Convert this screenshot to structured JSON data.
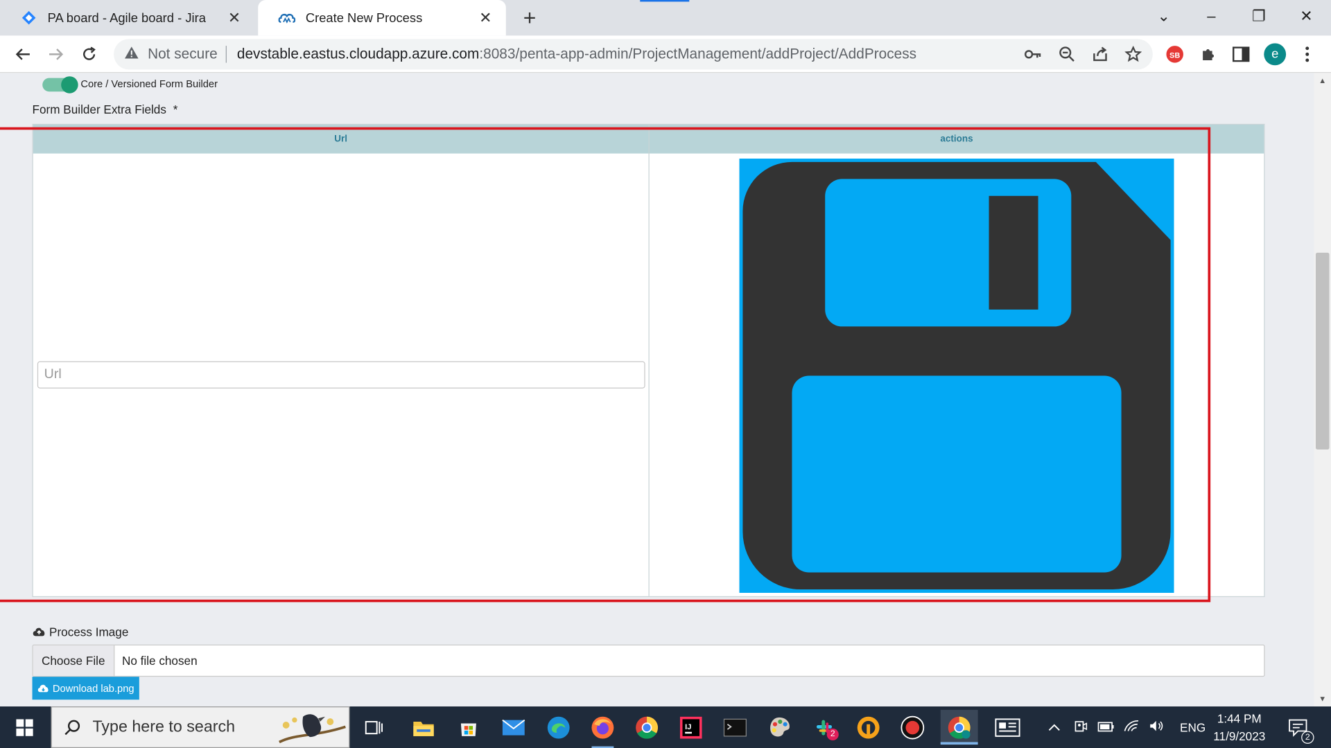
{
  "browser": {
    "tabs": [
      {
        "title": "PA board - Agile board - Jira",
        "icon": "jira-icon"
      },
      {
        "title": "Create New Process",
        "icon": "app-cloud-icon"
      }
    ],
    "security_label": "Not secure",
    "url_host": "devstable.eastus.cloudapp.azure.com",
    "url_path": ":8083/penta-app-admin/ProjectManagement/addProject/AddProcess",
    "profile_initial": "e"
  },
  "page": {
    "toggle_label": "Core / Versioned Form Builder",
    "section_label": "Form Builder Extra Fields",
    "required_mark": "*",
    "grid": {
      "columns": [
        "Url",
        "actions"
      ],
      "url_placeholder": "Url"
    },
    "process_image_label": "Process Image",
    "choose_file_label": "Choose File",
    "no_file_label": "No file chosen",
    "download_label": "Download lab.png"
  },
  "taskbar": {
    "search_placeholder": "Type here to search",
    "language": "ENG",
    "time": "1:44 PM",
    "date": "11/9/2023",
    "notification_count": "2",
    "slack_badge": "2"
  },
  "colors": {
    "save_icon_bg": "#03a9f4",
    "save_icon_body": "#333333",
    "grid_header": "#b8d4d8",
    "highlight": "#d9161e",
    "download_button": "#1a9ddb"
  }
}
